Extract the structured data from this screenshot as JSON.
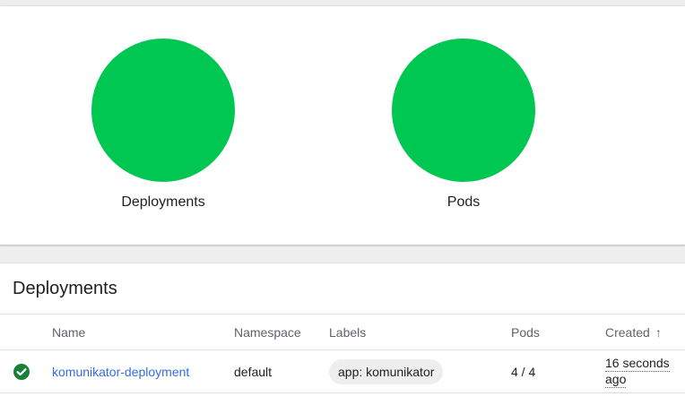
{
  "charts": [
    {
      "label": "Deployments",
      "color": "#00c752",
      "fill_fraction": 1.0
    },
    {
      "label": "Pods",
      "color": "#00c752",
      "fill_fraction": 1.0
    }
  ],
  "table": {
    "title": "Deployments",
    "headers": {
      "name": "Name",
      "namespace": "Namespace",
      "labels": "Labels",
      "pods": "Pods",
      "created": "Created",
      "created_sort_icon": "arrow-up-icon"
    },
    "rows": [
      {
        "status_icon": "check-circle-icon",
        "status_color": "#188038",
        "name": "komunikator-deployment",
        "namespace": "default",
        "label": "app: komunikator",
        "pods": "4 / 4",
        "created_line1": "16 seconds",
        "created_line2": "ago"
      }
    ]
  }
}
